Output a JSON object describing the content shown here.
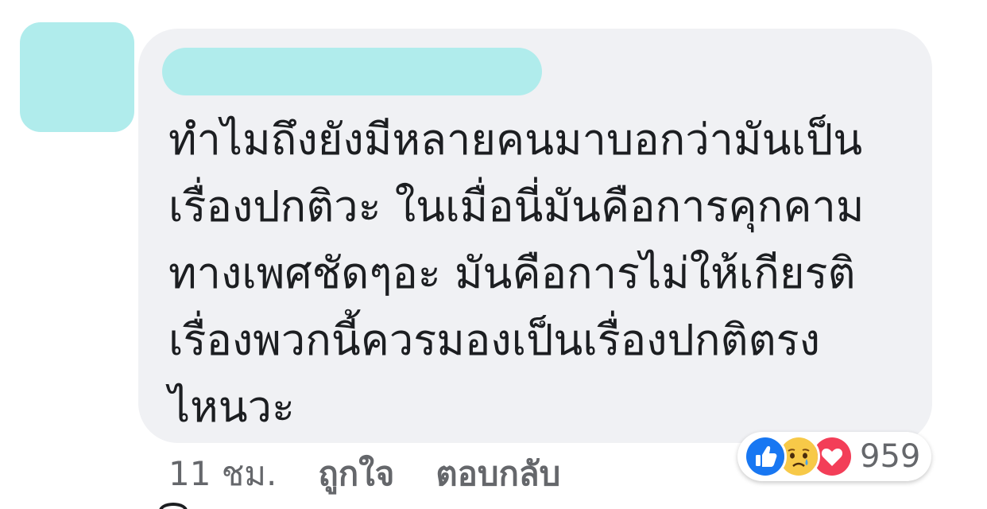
{
  "comment": {
    "text": "ทำไมถึงยังมีหลายคนมาบอกว่ามันเป็น\nเรื่องปกติวะ ในเมื่อนี่มันคือการคุกคาม\nทางเพศชัดๆอะ มันคือการไม่ให้เกียรติ\nเรื่องพวกนี้ควรมองเป็นเรื่องปกติตรง\nไหนวะ"
  },
  "actions": {
    "timestamp": "11 ชม.",
    "like_label": "ถูกใจ",
    "reply_label": "ตอบกลับ"
  },
  "reactions": {
    "icons": [
      "like-icon",
      "sad-icon",
      "love-icon"
    ],
    "count": "959"
  },
  "colors": {
    "redaction": "#b0ecec",
    "bubble": "#f0f1f4",
    "like_blue": "#1877f2",
    "love_red": "#f33e58",
    "sad_yellow": "#f7c948",
    "text": "#1c1e21",
    "meta_text": "#65676b"
  }
}
